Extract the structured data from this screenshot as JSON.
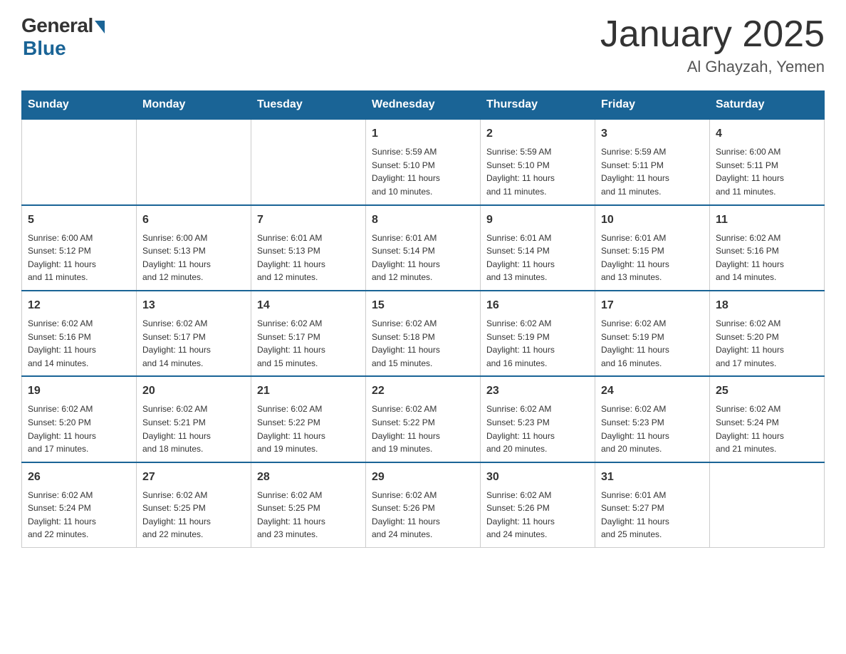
{
  "logo": {
    "general": "General",
    "blue": "Blue",
    "subtitle": "Blue"
  },
  "header": {
    "title": "January 2025",
    "subtitle": "Al Ghayzah, Yemen"
  },
  "weekdays": [
    "Sunday",
    "Monday",
    "Tuesday",
    "Wednesday",
    "Thursday",
    "Friday",
    "Saturday"
  ],
  "weeks": [
    [
      {
        "day": "",
        "info": ""
      },
      {
        "day": "",
        "info": ""
      },
      {
        "day": "",
        "info": ""
      },
      {
        "day": "1",
        "info": "Sunrise: 5:59 AM\nSunset: 5:10 PM\nDaylight: 11 hours\nand 10 minutes."
      },
      {
        "day": "2",
        "info": "Sunrise: 5:59 AM\nSunset: 5:10 PM\nDaylight: 11 hours\nand 11 minutes."
      },
      {
        "day": "3",
        "info": "Sunrise: 5:59 AM\nSunset: 5:11 PM\nDaylight: 11 hours\nand 11 minutes."
      },
      {
        "day": "4",
        "info": "Sunrise: 6:00 AM\nSunset: 5:11 PM\nDaylight: 11 hours\nand 11 minutes."
      }
    ],
    [
      {
        "day": "5",
        "info": "Sunrise: 6:00 AM\nSunset: 5:12 PM\nDaylight: 11 hours\nand 11 minutes."
      },
      {
        "day": "6",
        "info": "Sunrise: 6:00 AM\nSunset: 5:13 PM\nDaylight: 11 hours\nand 12 minutes."
      },
      {
        "day": "7",
        "info": "Sunrise: 6:01 AM\nSunset: 5:13 PM\nDaylight: 11 hours\nand 12 minutes."
      },
      {
        "day": "8",
        "info": "Sunrise: 6:01 AM\nSunset: 5:14 PM\nDaylight: 11 hours\nand 12 minutes."
      },
      {
        "day": "9",
        "info": "Sunrise: 6:01 AM\nSunset: 5:14 PM\nDaylight: 11 hours\nand 13 minutes."
      },
      {
        "day": "10",
        "info": "Sunrise: 6:01 AM\nSunset: 5:15 PM\nDaylight: 11 hours\nand 13 minutes."
      },
      {
        "day": "11",
        "info": "Sunrise: 6:02 AM\nSunset: 5:16 PM\nDaylight: 11 hours\nand 14 minutes."
      }
    ],
    [
      {
        "day": "12",
        "info": "Sunrise: 6:02 AM\nSunset: 5:16 PM\nDaylight: 11 hours\nand 14 minutes."
      },
      {
        "day": "13",
        "info": "Sunrise: 6:02 AM\nSunset: 5:17 PM\nDaylight: 11 hours\nand 14 minutes."
      },
      {
        "day": "14",
        "info": "Sunrise: 6:02 AM\nSunset: 5:17 PM\nDaylight: 11 hours\nand 15 minutes."
      },
      {
        "day": "15",
        "info": "Sunrise: 6:02 AM\nSunset: 5:18 PM\nDaylight: 11 hours\nand 15 minutes."
      },
      {
        "day": "16",
        "info": "Sunrise: 6:02 AM\nSunset: 5:19 PM\nDaylight: 11 hours\nand 16 minutes."
      },
      {
        "day": "17",
        "info": "Sunrise: 6:02 AM\nSunset: 5:19 PM\nDaylight: 11 hours\nand 16 minutes."
      },
      {
        "day": "18",
        "info": "Sunrise: 6:02 AM\nSunset: 5:20 PM\nDaylight: 11 hours\nand 17 minutes."
      }
    ],
    [
      {
        "day": "19",
        "info": "Sunrise: 6:02 AM\nSunset: 5:20 PM\nDaylight: 11 hours\nand 17 minutes."
      },
      {
        "day": "20",
        "info": "Sunrise: 6:02 AM\nSunset: 5:21 PM\nDaylight: 11 hours\nand 18 minutes."
      },
      {
        "day": "21",
        "info": "Sunrise: 6:02 AM\nSunset: 5:22 PM\nDaylight: 11 hours\nand 19 minutes."
      },
      {
        "day": "22",
        "info": "Sunrise: 6:02 AM\nSunset: 5:22 PM\nDaylight: 11 hours\nand 19 minutes."
      },
      {
        "day": "23",
        "info": "Sunrise: 6:02 AM\nSunset: 5:23 PM\nDaylight: 11 hours\nand 20 minutes."
      },
      {
        "day": "24",
        "info": "Sunrise: 6:02 AM\nSunset: 5:23 PM\nDaylight: 11 hours\nand 20 minutes."
      },
      {
        "day": "25",
        "info": "Sunrise: 6:02 AM\nSunset: 5:24 PM\nDaylight: 11 hours\nand 21 minutes."
      }
    ],
    [
      {
        "day": "26",
        "info": "Sunrise: 6:02 AM\nSunset: 5:24 PM\nDaylight: 11 hours\nand 22 minutes."
      },
      {
        "day": "27",
        "info": "Sunrise: 6:02 AM\nSunset: 5:25 PM\nDaylight: 11 hours\nand 22 minutes."
      },
      {
        "day": "28",
        "info": "Sunrise: 6:02 AM\nSunset: 5:25 PM\nDaylight: 11 hours\nand 23 minutes."
      },
      {
        "day": "29",
        "info": "Sunrise: 6:02 AM\nSunset: 5:26 PM\nDaylight: 11 hours\nand 24 minutes."
      },
      {
        "day": "30",
        "info": "Sunrise: 6:02 AM\nSunset: 5:26 PM\nDaylight: 11 hours\nand 24 minutes."
      },
      {
        "day": "31",
        "info": "Sunrise: 6:01 AM\nSunset: 5:27 PM\nDaylight: 11 hours\nand 25 minutes."
      },
      {
        "day": "",
        "info": ""
      }
    ]
  ]
}
